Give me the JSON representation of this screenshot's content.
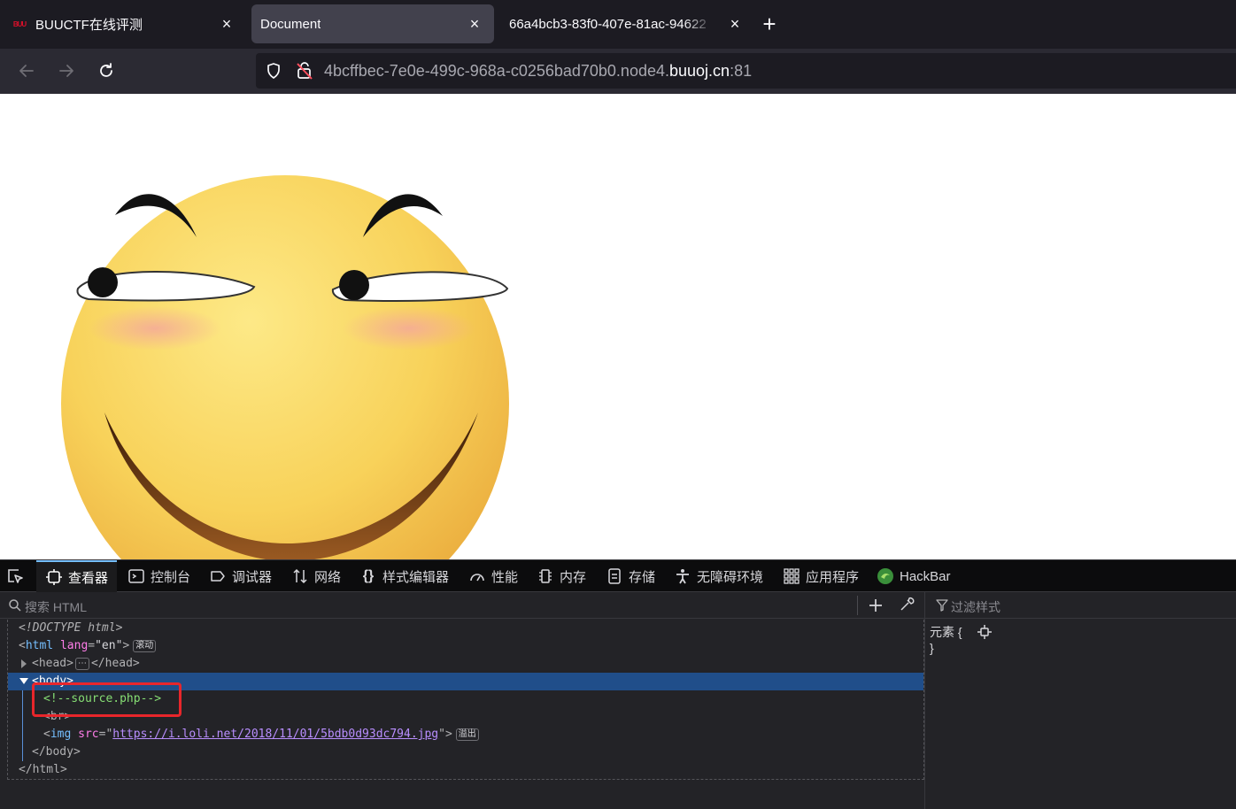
{
  "browser": {
    "tabs": [
      {
        "label": "BUUCTF在线评测",
        "favicon_text": "BUU",
        "active": false
      },
      {
        "label": "Document",
        "active": true
      },
      {
        "label": "66a4bcb3-83f0-407e-81ac-94622",
        "active": false
      }
    ],
    "close_glyph": "×",
    "new_tab_glyph": "+",
    "url": {
      "prefix": "4bcffbec-7e0e-499c-968a-c0256bad70b0.node4.",
      "host": "buuoj.cn",
      "suffix": ":81"
    }
  },
  "page": {
    "image_subject": "smirking smiley face"
  },
  "devtools": {
    "tabs": [
      {
        "label": "查看器",
        "icon": "inspector-icon",
        "active": true
      },
      {
        "label": "控制台",
        "icon": "console-icon"
      },
      {
        "label": "调试器",
        "icon": "debugger-icon"
      },
      {
        "label": "网络",
        "icon": "network-icon"
      },
      {
        "label": "样式编辑器",
        "icon": "style-editor-icon"
      },
      {
        "label": "性能",
        "icon": "performance-icon"
      },
      {
        "label": "内存",
        "icon": "memory-icon"
      },
      {
        "label": "存储",
        "icon": "storage-icon"
      },
      {
        "label": "无障碍环境",
        "icon": "accessibility-icon"
      },
      {
        "label": "应用程序",
        "icon": "application-icon"
      },
      {
        "label": "HackBar",
        "icon": "hackbar-icon"
      }
    ],
    "search_placeholder": "搜索 HTML",
    "filter_placeholder": "过滤样式",
    "tree": {
      "doctype": "<!DOCTYPE html>",
      "html_open_tag": "html",
      "html_attr_name": "lang",
      "html_attr_value": "\"en\"",
      "html_badge": "滚动",
      "head_open": "<head>",
      "head_close": "</head>",
      "head_collapsed": "⋯",
      "body_open": "<body>",
      "comment": "<!--source.php-->",
      "br_tag": "<br>",
      "img_tag": "img",
      "img_attr_name": "src",
      "img_src": "https://i.loli.net/2018/11/01/5bdb0d93dc794.jpg",
      "img_badge": "溢出",
      "body_close": "</body>",
      "html_close": "</html>"
    },
    "rules": {
      "selector": "元素 {",
      "close": "}"
    }
  },
  "colors": {
    "accent": "#75bfff",
    "selection": "#204e8a",
    "highlight_box": "#e8262b"
  }
}
